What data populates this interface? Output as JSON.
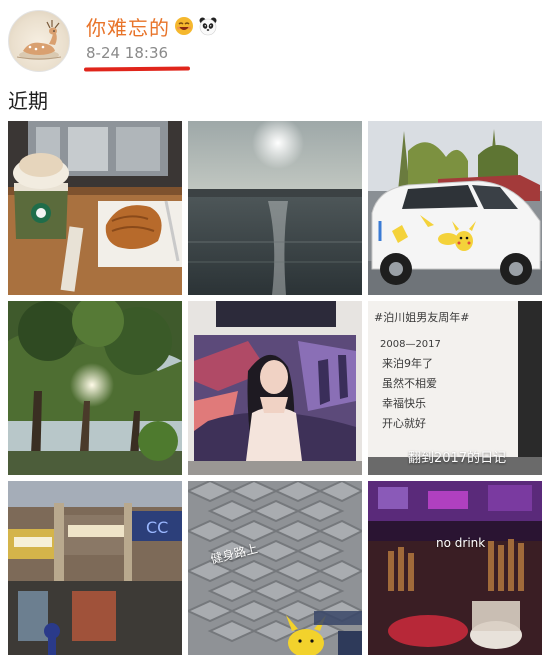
{
  "post": {
    "nickname": "你难忘的",
    "badges": [
      "smiling-face-emoji-icon",
      "panda-icon"
    ],
    "timestamp": "8-24 18:36",
    "section_title": "近期"
  },
  "photos": [
    {
      "name": "coffee-croissant-photo",
      "caption": ""
    },
    {
      "name": "sunset-lake-photo",
      "caption": ""
    },
    {
      "name": "pikachu-car-photo",
      "caption": ""
    },
    {
      "name": "sunlit-trees-photo",
      "caption": ""
    },
    {
      "name": "woman-painting-photo",
      "caption": ""
    },
    {
      "name": "diary-page-photo",
      "caption": "翻到2017的日记"
    },
    {
      "name": "mall-street-photo",
      "caption": ""
    },
    {
      "name": "paving-stones-photo",
      "caption": "健身路上"
    },
    {
      "name": "bar-table-photo",
      "caption": "no drink"
    }
  ],
  "diary": {
    "heading": "#泊川姐男友周年#",
    "lines": [
      "2008—2017",
      "来泊9年了",
      "虽然不相爱",
      "幸福快乐",
      "开心就好"
    ]
  },
  "colors": {
    "nickname": "#e8742a",
    "timestamp": "#8a8a8a",
    "underline": "#e0251b"
  }
}
